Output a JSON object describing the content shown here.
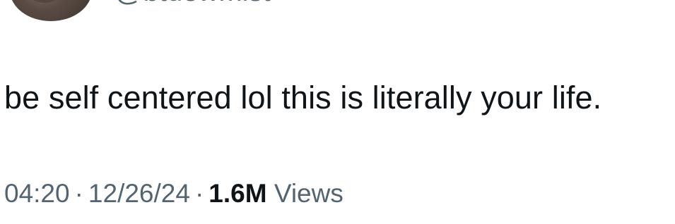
{
  "author": {
    "handle": "@btdewmist"
  },
  "tweet": {
    "text": "be self centered lol this is literally your life."
  },
  "meta": {
    "time": "04:20",
    "separator": "·",
    "date": "12/26/24",
    "views_count": "1.6M",
    "views_label": "Views"
  }
}
